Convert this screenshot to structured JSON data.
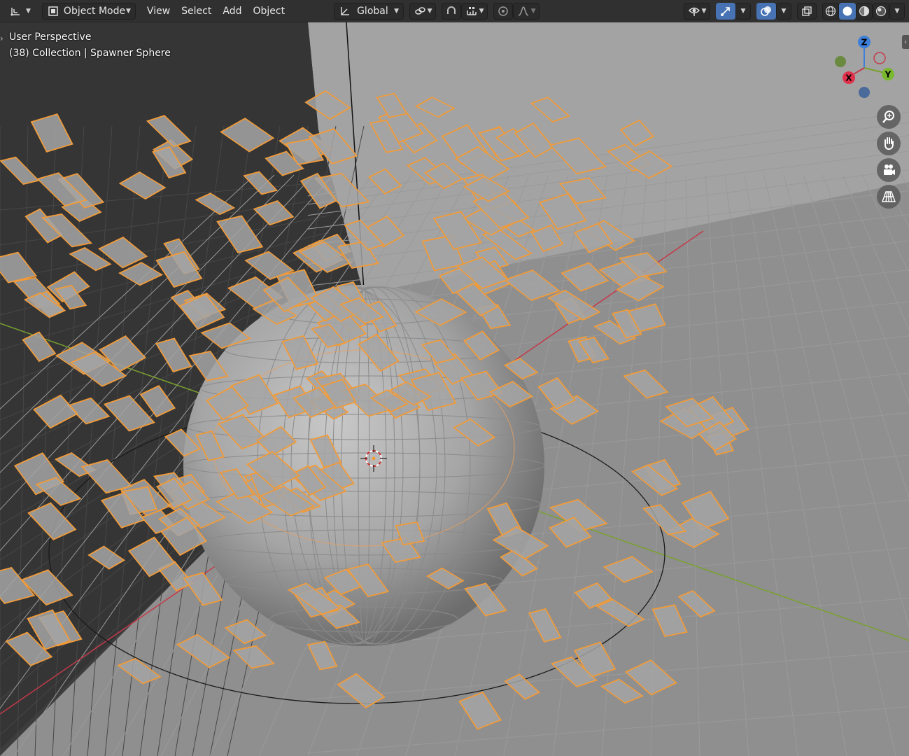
{
  "header": {
    "editor_type_icon": "axes-grid-icon",
    "mode_label": "Object Mode",
    "menus": [
      "View",
      "Select",
      "Add",
      "Object"
    ],
    "transform_orientation": "Global"
  },
  "overlay": {
    "perspective_label": "User Perspective",
    "collection_label": "(38) Collection | Spawner Sphere"
  },
  "gizmo": {
    "z_label": "Z",
    "y_label": "Y",
    "x_label": "X"
  },
  "nav_buttons": [
    "zoom-icon",
    "pan-hand-icon",
    "camera-icon",
    "perspective-grid-icon"
  ],
  "colors": {
    "selection_orange": "#f29b38",
    "x_axis": "#c33a4a",
    "y_axis": "#7aa02f",
    "z_axis": "#3d7fd9",
    "active_button": "#4772b3"
  }
}
